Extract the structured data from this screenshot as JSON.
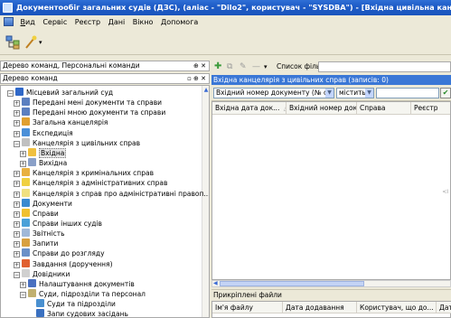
{
  "window": {
    "title": "Документообіг загальних судів (ДЗС), (аліас - \"Dilo2\", користувач - \"SYSDBA\") - [Вхідна цивільна канцелярія]"
  },
  "menu": {
    "items": [
      {
        "label": "Вид",
        "underline": "В",
        "rest": "ид"
      },
      {
        "label": "Сервіс"
      },
      {
        "label": "Реєстр"
      },
      {
        "label": "Дані"
      },
      {
        "label": "Вікно"
      },
      {
        "label": "Допомога"
      }
    ]
  },
  "left_panel": {
    "header1": "Дерево команд, Персональні команди",
    "header1_ctl": "⊕ ✕",
    "header2": "Дерево команд",
    "header2_ctl": "▫ ⊕ ✕",
    "tree": [
      {
        "label": "Місцевий загальний суд",
        "exp": "−",
        "color": "#2f68c8"
      },
      {
        "label": "Передані мені документи та справи",
        "exp": "+",
        "color": "#5b7fc0"
      },
      {
        "label": "Передані мною документи та справи",
        "exp": "+",
        "color": "#5b7fc0"
      },
      {
        "label": "Загальна канцелярія",
        "exp": "+",
        "color": "#e0a030"
      },
      {
        "label": "Експедиція",
        "exp": "+",
        "color": "#4a8fd8"
      },
      {
        "label": "Канцелярія з цивільних справ",
        "exp": "−",
        "color": "#c0c0c0"
      },
      {
        "label": "Вхідна",
        "exp": "+",
        "color": "#f0c040",
        "selected": true
      },
      {
        "label": "Вихідна",
        "exp": "+",
        "color": "#8aa0c8"
      },
      {
        "label": "Канцелярія з кримінальних справ",
        "exp": "+",
        "color": "#e8b040"
      },
      {
        "label": "Канцелярія з адміністративних справ",
        "exp": "+",
        "color": "#f0d040"
      },
      {
        "label": "Канцелярія з справ про адміністративні правоп...",
        "exp": "+",
        "color": "#f0e080"
      },
      {
        "label": "Документи",
        "exp": "+",
        "color": "#3a8ad0"
      },
      {
        "label": "Справи",
        "exp": "+",
        "color": "#f0c030"
      },
      {
        "label": "Справи інших судів",
        "exp": "+",
        "color": "#4aa0d8"
      },
      {
        "label": "Звітність",
        "exp": "+",
        "color": "#a0b8d8"
      },
      {
        "label": "Запити",
        "exp": "+",
        "color": "#d8a040"
      },
      {
        "label": "Справи до розгляду",
        "exp": "+",
        "color": "#6a90c8"
      },
      {
        "label": "Завдання (доручення)",
        "exp": "+",
        "color": "#e06030"
      },
      {
        "label": "Довідники",
        "exp": "−",
        "color": "#d0d0d0"
      },
      {
        "label": "Налаштування документів",
        "exp": "+",
        "color": "#4a70c0"
      },
      {
        "label": "Суди, підрозділи та персонал",
        "exp": "−",
        "color": "#c0b070"
      },
      {
        "label": "Суди та підрозділи",
        "exp": "",
        "color": "#4a90d0"
      },
      {
        "label": "Запи судових засідань",
        "exp": "",
        "color": "#3a70c0"
      }
    ]
  },
  "right_panel": {
    "filter_label": "Список фільтрів:",
    "title": "Вхідна канцелярія з цивільних справ (записів: 0)",
    "filter_field": "Вхідний номер документу  (№ справи)",
    "filter_op": "містить",
    "columns": [
      "Вхідна дата док...",
      "Вхідний номер доку...",
      "Справа",
      "Реєстр"
    ],
    "attachments_title": "Прикріплені файли",
    "att_columns": [
      "Ім'я файлу",
      "Дата додавання",
      "Користувач, що до...",
      "Дата"
    ]
  }
}
